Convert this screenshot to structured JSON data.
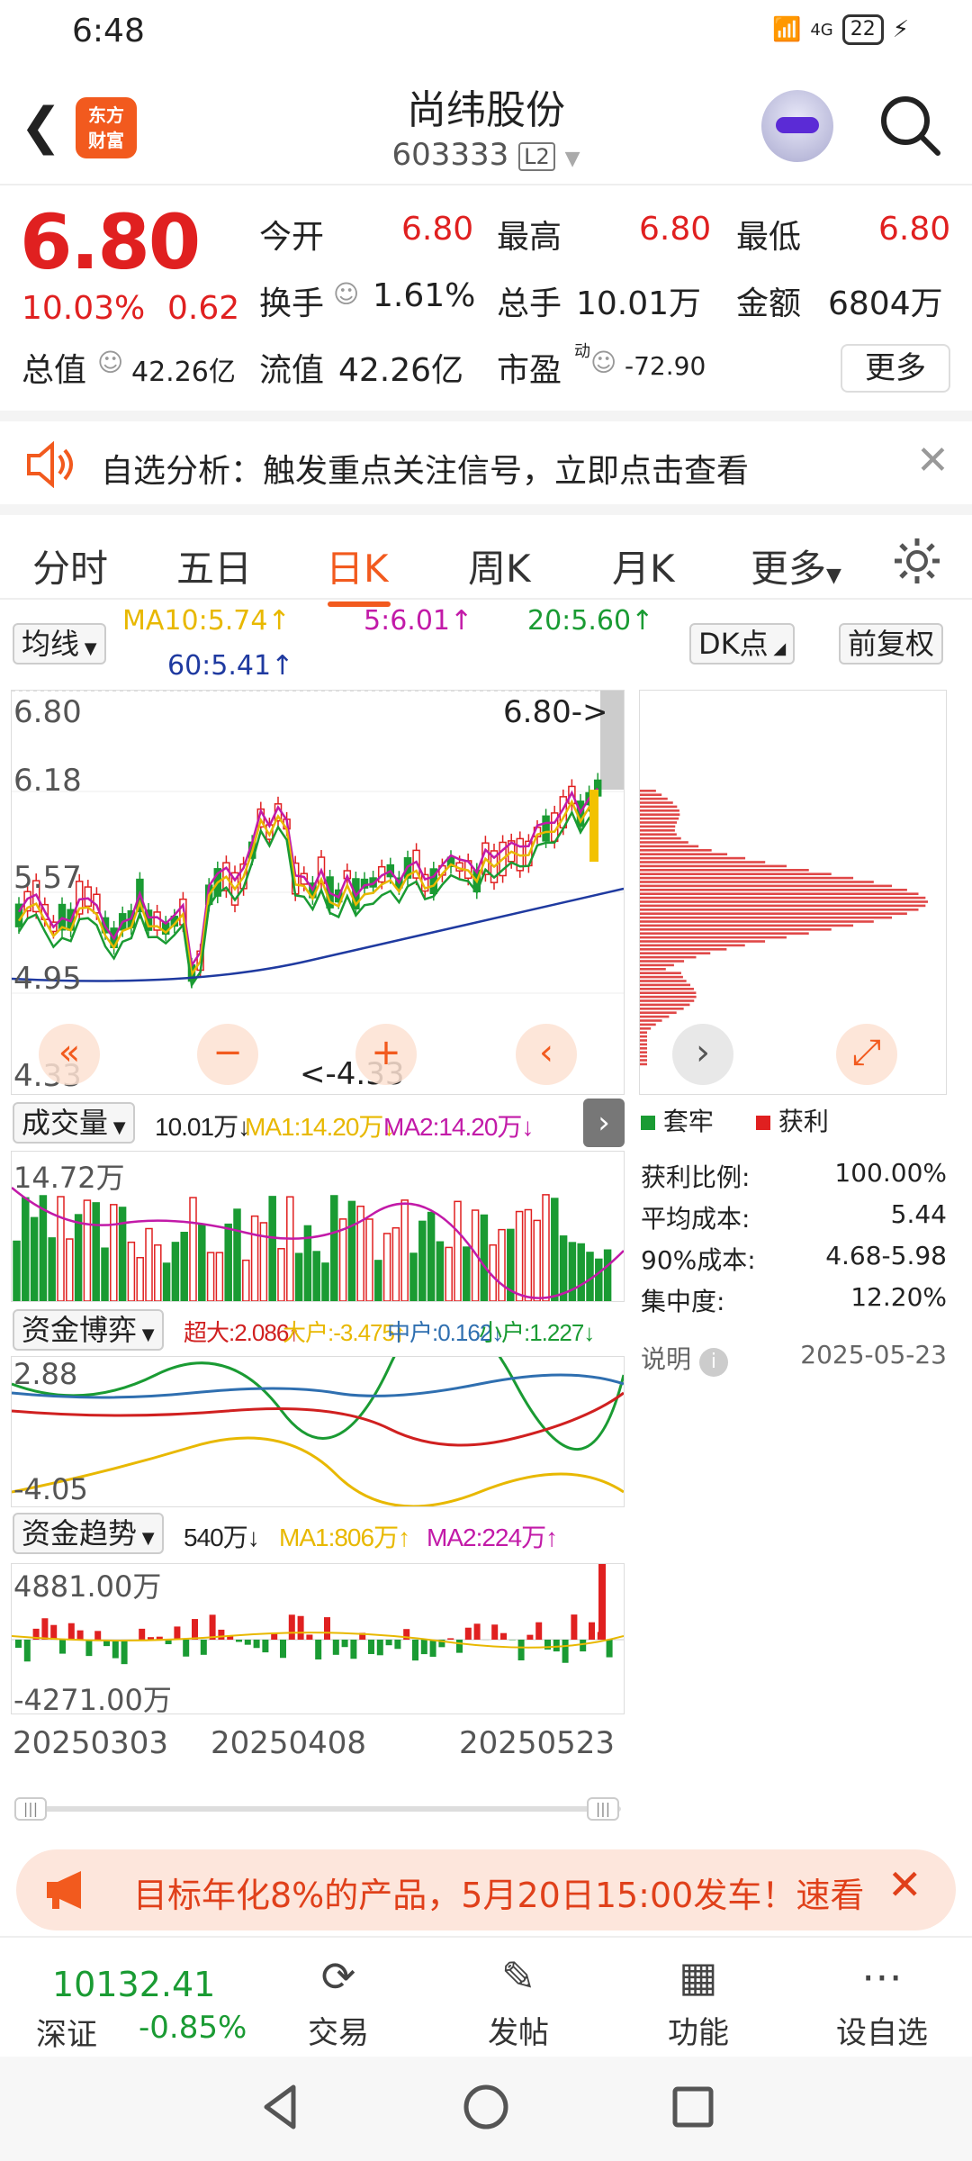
{
  "status": {
    "time": "6:48",
    "net": "4G",
    "battery": "22"
  },
  "header": {
    "title": "尚纬股份",
    "code": "603333",
    "level": "L2",
    "logo_line1": "东方",
    "logo_line2": "财富"
  },
  "quote": {
    "price": "6.80",
    "pct": "10.03%",
    "chg": "0.62",
    "open_label": "今开",
    "open": "6.80",
    "high_label": "最高",
    "high": "6.80",
    "low_label": "最低",
    "low": "6.80",
    "turnover_label": "换手",
    "turnover": "1.61%",
    "volume_label": "总手",
    "volume": "10.01万",
    "amount_label": "金额",
    "amount": "6804万",
    "mktcap_label": "总值",
    "mktcap": "42.26亿",
    "float_label": "流值",
    "float": "42.26亿",
    "pe_label": "市盈",
    "pe_sup": "动",
    "pe": "-72.90",
    "more": "更多"
  },
  "notice": {
    "text": "自选分析：触发重点关注信号，立即点击查看"
  },
  "tabs": [
    "分时",
    "五日",
    "日K",
    "周K",
    "月K",
    "更多"
  ],
  "active_tab": "日K",
  "ma_bar": {
    "select": "均线",
    "ma10": "MA10:5.74↑",
    "ma5": "5:6.01↑",
    "ma20": "20:5.60↑",
    "ma60": "60:5.41↑",
    "dk": "DK点",
    "adjust": "前复权"
  },
  "kline": {
    "labels": [
      "6.80",
      "6.18",
      "5.57",
      "4.95",
      "4.33"
    ],
    "last_tag": "6.80->",
    "low_tag": "<-4.33"
  },
  "chart_data": {
    "type": "bar",
    "chip_distribution": true,
    "price_range": [
      4.33,
      6.8
    ],
    "legend": [
      "套牢",
      "获利"
    ]
  },
  "chip_stats": {
    "legend_loss": "套牢",
    "legend_profit": "获利",
    "rows": [
      {
        "k": "获利比例:",
        "v": "100.00%"
      },
      {
        "k": "平均成本:",
        "v": "5.44"
      },
      {
        "k": "90%成本:",
        "v": "4.68-5.98"
      },
      {
        "k": "集中度:",
        "v": "12.20%"
      }
    ],
    "note": "说明",
    "date": "2025-05-23"
  },
  "vol": {
    "select": "成交量",
    "v": "10.01万↓",
    "ma1": "MA1:14.20万↓",
    "ma2": "MA2:14.20万↓",
    "top": "14.72万"
  },
  "fund": {
    "select": "资金博弈",
    "a": "超大:2.086↑",
    "b": "大户:-3.475↑",
    "c": "中户:0.162↓",
    "d": "小户:1.227↓",
    "top": "2.88",
    "bottom": "-4.05"
  },
  "trend": {
    "select": "资金趋势",
    "v": "540万↓",
    "ma1": "MA1:806万↑",
    "ma2": "MA2:224万↑",
    "top": "4881.00万",
    "bottom": "-4271.00万"
  },
  "dates": [
    "20250303",
    "20250408",
    "20250523"
  ],
  "promo": {
    "text": "目标年化8%的产品，5月20日15:00发车！速看"
  },
  "bottom": {
    "index_value": "10132.41",
    "index_name": "深证",
    "index_pct": "-0.85%",
    "items": [
      "交易",
      "发帖",
      "功能",
      "设自选"
    ]
  }
}
